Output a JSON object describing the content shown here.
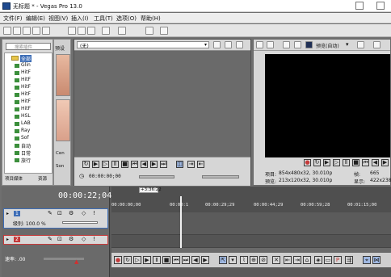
{
  "window": {
    "title": "无标题 * - Vegas Pro 13.0"
  },
  "menu": {
    "items": [
      "文件(F)",
      "编辑(E)",
      "视图(V)",
      "插入(I)",
      "工具(T)",
      "选项(O)",
      "帮助(H)"
    ]
  },
  "explorer": {
    "search_placeholder": "搜索插件",
    "tree_root": "全部",
    "tree_items": [
      "Glin",
      "HitF",
      "HitF",
      "HitF",
      "HitF",
      "HitF",
      "HitF",
      "HSL",
      "LAB",
      "Ray",
      "Sof",
      "自动",
      "日常",
      "旅行"
    ],
    "tabs": [
      "项目媒体",
      "资源"
    ]
  },
  "preset_strip": {
    "title": "预设",
    "thumb_label_1": "Cen",
    "thumb_label_2": "Son"
  },
  "trimmer": {
    "dropdown_value": "(无)",
    "timecode": "00:00:00;00"
  },
  "preview": {
    "mode_label": "预览(自动)",
    "info_lines": [
      {
        "label": "项目:",
        "value": "854x480x32, 30.010p"
      },
      {
        "label": "预览:",
        "value": "213x120x32, 30.010p"
      }
    ],
    "right_info": [
      {
        "label": "帧:",
        "value": "665"
      },
      {
        "label": "显示:",
        "value": "422x238"
      }
    ]
  },
  "timeline": {
    "current_time": "00:00:22;04",
    "cursor_label": "+3:36:22",
    "ruler_labels": [
      "00:00:00;00",
      "00:00:1",
      "00:00:29;29",
      "00:00:44;29",
      "00:00:59;28",
      "00:01:15;00"
    ],
    "track1": {
      "number": "1",
      "level_label": "级别: 100.0 %"
    },
    "track2": {
      "number": "2"
    },
    "rate_label": "速率: .00"
  },
  "colors": {
    "accent_blue": "#3d6db6",
    "track_audio_red": "#c53a3a"
  }
}
